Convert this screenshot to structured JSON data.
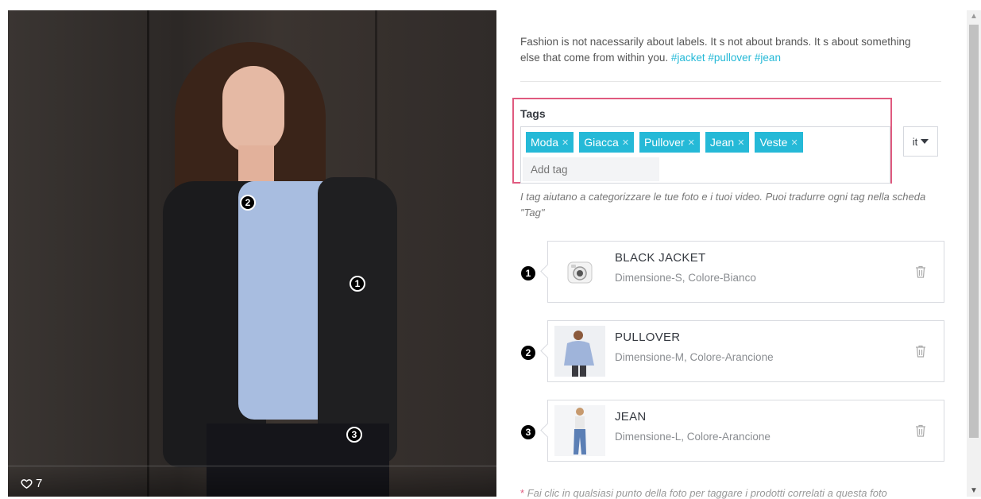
{
  "photo": {
    "likes": "7",
    "markers": [
      "1",
      "2",
      "3"
    ]
  },
  "caption": {
    "text": "Fashion is not nacessarily about labels. It s not about brands. It s about something else that come from within you.",
    "hashtags": "#jacket #pullover #jean"
  },
  "tags": {
    "label": "Tags",
    "chips": [
      "Moda",
      "Giacca",
      "Pullover",
      "Jean",
      "Veste"
    ],
    "add_placeholder": "Add tag",
    "language": "it",
    "help": "I tag aiutano a categorizzare le tue foto e i tuoi video. Puoi tradurre ogni tag nella scheda \"Tag\""
  },
  "products": [
    {
      "num": "1",
      "name": "BLACK JACKET",
      "attrs": "Dimensione-S, Colore-Bianco",
      "thumb": "camera-icon"
    },
    {
      "num": "2",
      "name": "PULLOVER",
      "attrs": "Dimensione-M, Colore-Arancione",
      "thumb": "pullover-image"
    },
    {
      "num": "3",
      "name": "JEAN",
      "attrs": "Dimensione-L, Colore-Arancione",
      "thumb": "jean-image"
    }
  ],
  "footnote": {
    "star": "*",
    "text": "Fai clic in qualsiasi punto della foto per taggare i prodotti correlati a questa foto"
  },
  "colors": {
    "accent": "#25b9d7",
    "highlight": "#e05a7f"
  }
}
